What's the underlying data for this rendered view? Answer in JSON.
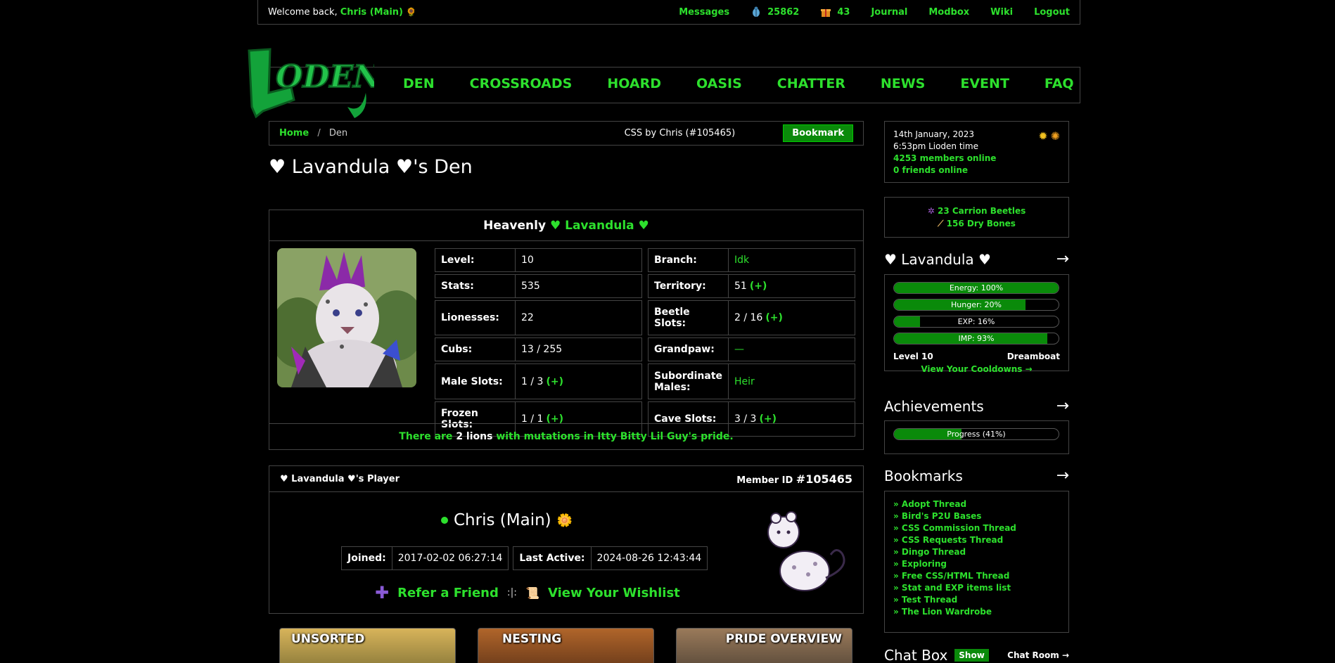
{
  "topbar": {
    "welcome_prefix": "Welcome back,",
    "user_name": "Chris (Main)",
    "links": {
      "messages": "Messages",
      "beetles": "25862",
      "gifts": "43",
      "journal": "Journal",
      "modbox": "Modbox",
      "wiki": "Wiki",
      "logout": "Logout"
    }
  },
  "nav": [
    "DEN",
    "CROSSROADS",
    "HOARD",
    "OASIS",
    "CHATTER",
    "NEWS",
    "EVENT",
    "FAQ"
  ],
  "breadcrumb": {
    "home": "Home",
    "sep": "/",
    "current": "Den",
    "css_credit": "CSS by Chris (#105465)",
    "bookmark_btn": "Bookmark"
  },
  "den_title": "♥ Lavandula ♥'s Den",
  "lion": {
    "title_prefix": "Heavenly",
    "title_name": "♥ Lavandula ♥",
    "stats_left": [
      {
        "k": "Level:",
        "v": "10",
        "extra": ""
      },
      {
        "k": "Stats:",
        "v": "535",
        "extra": ""
      },
      {
        "k": "Lionesses:",
        "v": "22",
        "extra": ""
      },
      {
        "k": "Cubs:",
        "v": "13 / 255",
        "extra": ""
      },
      {
        "k": "Male Slots:",
        "v": "1 / 3",
        "extra": "(+)"
      },
      {
        "k": "Frozen Slots:",
        "v": "1 / 1",
        "extra": "(+)"
      }
    ],
    "stats_right": [
      {
        "k": "Branch:",
        "v": "Idk",
        "extra": ""
      },
      {
        "k": "Territory:",
        "v": "51",
        "extra": "(+)"
      },
      {
        "k": "Beetle Slots:",
        "v": "2 / 16",
        "extra": "(+)"
      },
      {
        "k": "Grandpaw:",
        "v": "—",
        "extra": ""
      },
      {
        "k": "Subordinate Males:",
        "v": "Heir",
        "extra": ""
      },
      {
        "k": "Cave Slots:",
        "v": "3 / 3",
        "extra": "(+)"
      }
    ],
    "mutations_pre": "There are",
    "mutations_count": "2 lions",
    "mutations_post": "with mutations in Itty Bitty Lil Guy's pride."
  },
  "player": {
    "head_left": "♥ Lavandula ♥'s Player",
    "head_right_label": "Member ID",
    "head_right_value": "#105465",
    "name": "Chris (Main)",
    "joined_label": "Joined:",
    "joined_value": "2017-02-02 06:27:14",
    "active_label": "Last Active:",
    "active_value": "2024-08-26 12:43:44",
    "refer": "Refer a Friend",
    "divider": ":|:",
    "wishlist": "View Your Wishlist"
  },
  "panels": [
    "UNSORTED",
    "NESTING",
    "PRIDE OVERVIEW"
  ],
  "sidebar": {
    "date": "14th January, 2023",
    "time": "6:53pm Lioden time",
    "members_online": "4253 members online",
    "friends_online": "0 friends online",
    "items": [
      "23 Carrion Beetles",
      "156 Dry Bones"
    ],
    "lion_title": "♥ Lavandula ♥",
    "arrow": "→",
    "bars": [
      {
        "label": "Energy: 100%",
        "value": 100
      },
      {
        "label": "Hunger: 20%",
        "value": 80
      },
      {
        "label": "EXP: 16%",
        "value": 16
      },
      {
        "label": "IMP: 93%",
        "value": 93
      }
    ],
    "level": "Level 10",
    "rank": "Dreamboat",
    "cooldowns": "View Your Cooldowns →",
    "achievements_title": "Achievements",
    "achievements_bar": {
      "label": "Progress (41%)",
      "value": 41
    },
    "bookmarks_title": "Bookmarks",
    "bookmarks": [
      "» Adopt Thread",
      "» Bird's P2U Bases",
      "» CSS Commission Thread",
      "» CSS Requests Thread",
      "» Dingo Thread",
      "» Exploring",
      "» Free CSS/HTML Thread",
      "» Stat and EXP items list",
      "» Test Thread",
      "» The Lion Wardrobe"
    ],
    "chat_title": "Chat Box",
    "chat_show": "Show",
    "chat_room": "Chat Room →"
  },
  "colors": {
    "accent": "#2de02d",
    "button": "#0a8a0a",
    "border": "#444444",
    "background": "#000000"
  }
}
